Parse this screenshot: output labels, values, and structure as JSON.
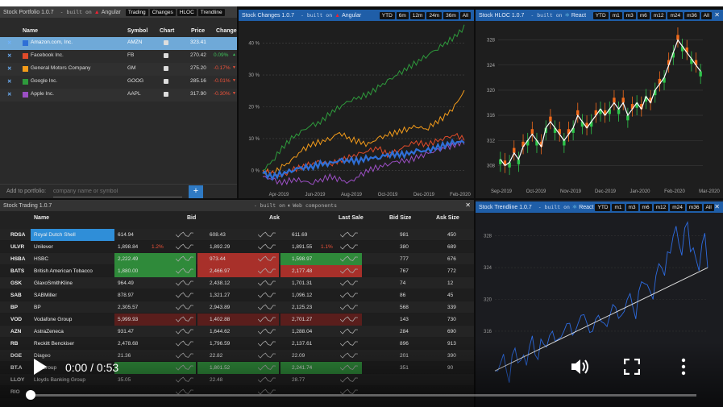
{
  "portfolio": {
    "title": "Stock Portfolio 1.0.7",
    "built_on": "- built on",
    "framework": "Angular",
    "tabs": [
      "Trading",
      "Changes",
      "HLOC",
      "Trendline"
    ],
    "columns": {
      "name": "Name",
      "symbol": "Symbol",
      "chart": "Chart",
      "price": "Price",
      "change": "Change"
    },
    "rows": [
      {
        "remove": "✕",
        "color": "#2f6fd6",
        "name": "Amazon.com, Inc.",
        "symbol": "AMZN",
        "price": "323.41",
        "change": "",
        "dir": "none",
        "selected": true
      },
      {
        "remove": "✕",
        "color": "#e04b2a",
        "name": "Facebook Inc.",
        "symbol": "FB",
        "price": "270.42",
        "change": "0.09%",
        "dir": "up",
        "selected": false
      },
      {
        "remove": "✕",
        "color": "#f59c1a",
        "name": "General Motors Company",
        "symbol": "GM",
        "price": "275.20",
        "change": "-0.17%",
        "dir": "down",
        "selected": false
      },
      {
        "remove": "✕",
        "color": "#2e9a3c",
        "name": "Google Inc.",
        "symbol": "GOOG",
        "price": "285.16",
        "change": "-0.01%",
        "dir": "down",
        "selected": false
      },
      {
        "remove": "✕",
        "color": "#9b4fc4",
        "name": "Apple Inc.",
        "symbol": "AAPL",
        "price": "317.90",
        "change": "-0.30%",
        "dir": "down",
        "selected": false
      }
    ],
    "add_label": "Add to portfolio:",
    "add_placeholder": "company name or symbol",
    "add_button": "+"
  },
  "changes": {
    "title": "Stock Changes 1.0.7",
    "built_on": "- built on",
    "framework": "Angular",
    "ranges": [
      "YTD",
      "6m",
      "12m",
      "24m",
      "36m",
      "All"
    ],
    "close": "✕"
  },
  "hloc": {
    "title": "Stock HLOC 1.0.7",
    "built_on": "- built on",
    "framework": "React",
    "ranges": [
      "YTD",
      "m1",
      "m3",
      "m6",
      "m12",
      "m24",
      "m36",
      "All"
    ],
    "close": "✕"
  },
  "trading": {
    "title": "Stock Trading 1.0.7",
    "built_on": "- built on",
    "framework": "Web components",
    "columns": {
      "name": "Name",
      "bid": "Bid",
      "ask": "Ask",
      "last": "Last Sale",
      "bidsize": "Bid Size",
      "asksize": "Ask Size"
    },
    "close": "✕",
    "rows": [
      {
        "sym": "RDSA",
        "name": "Royal Dutch Shell",
        "bid": "614.94",
        "ask": "608.43",
        "last": "611.69",
        "bidsize": "981",
        "asksize": "450",
        "bidchg": "",
        "askchg": "",
        "lastchg": "",
        "bidbg": "",
        "askbg": "",
        "lastbg": "",
        "hl": true
      },
      {
        "sym": "ULVR",
        "name": "Unilever",
        "bid": "1,898.84",
        "ask": "1,892.29",
        "last": "1,891.55",
        "bidsize": "380",
        "asksize": "689",
        "bidchg": "1.2%",
        "askchg": "",
        "lastchg": "1.1%",
        "bidbg": "",
        "askbg": "",
        "lastbg": "",
        "hl": false
      },
      {
        "sym": "HSBA",
        "name": "HSBC",
        "bid": "2,222.49",
        "ask": "973.44",
        "last": "1,598.97",
        "bidsize": "777",
        "asksize": "676",
        "bidchg": "",
        "askchg": "",
        "lastchg": "",
        "bidbg": "#2f8a3a",
        "askbg": "#a8302a",
        "lastbg": "#2f8a3a",
        "hl": false
      },
      {
        "sym": "BATS",
        "name": "British American Tobacco",
        "bid": "1,880.00",
        "ask": "2,466.97",
        "last": "2,177.48",
        "bidsize": "767",
        "asksize": "772",
        "bidchg": "",
        "askchg": "",
        "lastchg": "",
        "bidbg": "#2f8a3a",
        "askbg": "#a8302a",
        "lastbg": "#a8302a",
        "hl": false
      },
      {
        "sym": "GSK",
        "name": "GlaxoSmithKline",
        "bid": "964.49",
        "ask": "2,438.12",
        "last": "1,701.31",
        "bidsize": "74",
        "asksize": "12",
        "bidchg": "",
        "askchg": "",
        "lastchg": "",
        "bidbg": "",
        "askbg": "",
        "lastbg": "",
        "hl": false
      },
      {
        "sym": "SAB",
        "name": "SABMiller",
        "bid": "878.97",
        "ask": "1,321.27",
        "last": "1,096.12",
        "bidsize": "86",
        "asksize": "45",
        "bidchg": "",
        "askchg": "",
        "lastchg": "",
        "bidbg": "",
        "askbg": "",
        "lastbg": "",
        "hl": false
      },
      {
        "sym": "BP",
        "name": "BP",
        "bid": "2,305.57",
        "ask": "2,943.89",
        "last": "2,125.23",
        "bidsize": "568",
        "asksize": "339",
        "bidchg": "",
        "askchg": "",
        "lastchg": "",
        "bidbg": "",
        "askbg": "",
        "lastbg": "",
        "hl": false
      },
      {
        "sym": "VOD",
        "name": "Vodafone Group",
        "bid": "5,999.93",
        "ask": "1,402.88",
        "last": "2,701.27",
        "bidsize": "143",
        "asksize": "730",
        "bidchg": "",
        "askchg": "",
        "lastchg": "",
        "bidbg": "#5a1e1c",
        "askbg": "#5a1e1c",
        "lastbg": "#5a1e1c",
        "hl": false
      },
      {
        "sym": "AZN",
        "name": "AstraZeneca",
        "bid": "931.47",
        "ask": "1,644.62",
        "last": "1,288.04",
        "bidsize": "284",
        "asksize": "690",
        "bidchg": "",
        "askchg": "",
        "lastchg": "",
        "bidbg": "",
        "askbg": "",
        "lastbg": "",
        "hl": false
      },
      {
        "sym": "RB",
        "name": "Reckitt Benckiser",
        "bid": "2,478.68",
        "ask": "1,796.59",
        "last": "2,137.61",
        "bidsize": "896",
        "asksize": "913",
        "bidchg": "",
        "askchg": "",
        "lastchg": "",
        "bidbg": "",
        "askbg": "",
        "lastbg": "",
        "hl": false
      },
      {
        "sym": "DGE",
        "name": "Diageo",
        "bid": "21.36",
        "ask": "22.82",
        "last": "22.09",
        "bidsize": "201",
        "asksize": "390",
        "bidchg": "",
        "askchg": "",
        "lastchg": "",
        "bidbg": "",
        "askbg": "",
        "lastbg": "",
        "hl": false
      },
      {
        "sym": "BT.A",
        "name": "BT Group",
        "bid": "",
        "ask": "1,801.52",
        "last": "2,241.74",
        "bidsize": "351",
        "asksize": "90",
        "bidchg": "",
        "askchg": "",
        "lastchg": "",
        "bidbg": "#2f8a3a",
        "askbg": "#2f8a3a",
        "lastbg": "#2f8a3a",
        "hl": false
      },
      {
        "sym": "LLOY",
        "name": "Lloyds Banking Group",
        "bid": "35.05",
        "ask": "22.48",
        "last": "28.77",
        "bidsize": "",
        "asksize": "",
        "bidchg": "",
        "askchg": "",
        "lastchg": "",
        "bidbg": "",
        "askbg": "",
        "lastbg": "",
        "hl": false
      },
      {
        "sym": "RIO",
        "name": "",
        "bid": "",
        "ask": "",
        "last": "",
        "bidsize": "",
        "asksize": "",
        "bidchg": "",
        "askchg": "",
        "lastchg": "",
        "bidbg": "",
        "askbg": "",
        "lastbg": "",
        "hl": false
      }
    ]
  },
  "trendline": {
    "title": "Stock Trendline 1.0.7",
    "built_on": "- built on",
    "framework": "React",
    "ranges": [
      "YTD",
      "m1",
      "m3",
      "m6",
      "m12",
      "m24",
      "m36",
      "All"
    ],
    "close": "✕"
  },
  "video": {
    "time": "0:00 / 0:53",
    "progress": 0.0
  },
  "chart_data": [
    {
      "type": "line",
      "x_ticks": [
        "Apr-2019",
        "Jun-2019",
        "Aug-2019",
        "Oct-2019",
        "Dec-2019",
        "Feb-2020"
      ],
      "y_ticks": [
        "0 %",
        "10 %",
        "20 %",
        "30 %",
        "40 %"
      ],
      "ylim": [
        -5,
        45
      ],
      "series": [
        {
          "color": "#2e9a3c",
          "values": [
            0,
            3,
            7,
            10,
            12,
            14,
            15,
            18,
            20,
            22,
            23,
            24,
            26,
            28,
            30,
            32,
            34,
            36,
            38,
            40,
            42,
            45
          ]
        },
        {
          "color": "#f59c1a",
          "values": [
            0,
            -1,
            1,
            3,
            6,
            8,
            9,
            10,
            12,
            10,
            9,
            8,
            10,
            11,
            12,
            13,
            14,
            13,
            15,
            17,
            20,
            25
          ]
        },
        {
          "color": "#e04b2a",
          "values": [
            0,
            -1,
            -2,
            0,
            1,
            2,
            3,
            2,
            3,
            4,
            5,
            6,
            7,
            5,
            6,
            8,
            9,
            8,
            9,
            10,
            11,
            10
          ]
        },
        {
          "color": "#9b4fc4",
          "values": [
            -2,
            -3,
            -4,
            -3,
            -3,
            -4,
            -3,
            -2,
            -3,
            -4,
            -2,
            0,
            1,
            2,
            3,
            3,
            4,
            5,
            6,
            7,
            8,
            9
          ]
        },
        {
          "color": "#2f6fd6",
          "values": [
            -1,
            -2,
            -1,
            0,
            1,
            1,
            2,
            2,
            3,
            3,
            3,
            4,
            4,
            5,
            5,
            5,
            6,
            6,
            7,
            8,
            9,
            9
          ]
        }
      ]
    },
    {
      "type": "candlestick",
      "x_ticks": [
        "Sep-2019",
        "Oct-2019",
        "Nov-2019",
        "Dec-2019",
        "Jan-2020",
        "Feb-2020",
        "Mar-2020"
      ],
      "y_ticks": [
        "308",
        "312",
        "316",
        "320",
        "324",
        "328"
      ],
      "ylim": [
        306,
        330
      ],
      "closes": [
        309,
        308,
        308.5,
        310,
        309,
        311,
        312,
        313,
        312,
        311,
        314,
        315,
        314,
        313,
        312,
        313,
        314,
        316,
        315,
        314,
        315,
        316,
        317,
        316,
        317,
        318,
        317,
        318,
        316,
        317,
        318,
        317,
        319,
        318,
        320,
        321,
        322,
        324,
        326,
        328,
        327,
        326,
        325,
        324,
        323
      ]
    },
    {
      "type": "line",
      "y_ticks": [
        "316",
        "320",
        "324",
        "328"
      ],
      "ylim": [
        310,
        330
      ],
      "values": [
        311,
        312,
        311,
        313,
        312,
        313,
        314,
        313,
        315,
        314,
        316,
        315,
        316,
        317,
        316,
        318,
        317,
        316,
        318,
        317,
        318,
        319,
        318,
        320,
        319,
        321,
        322,
        321,
        323,
        324,
        326,
        328,
        327,
        329,
        326,
        325,
        327,
        324
      ],
      "trend": [
        311,
        324
      ]
    }
  ]
}
